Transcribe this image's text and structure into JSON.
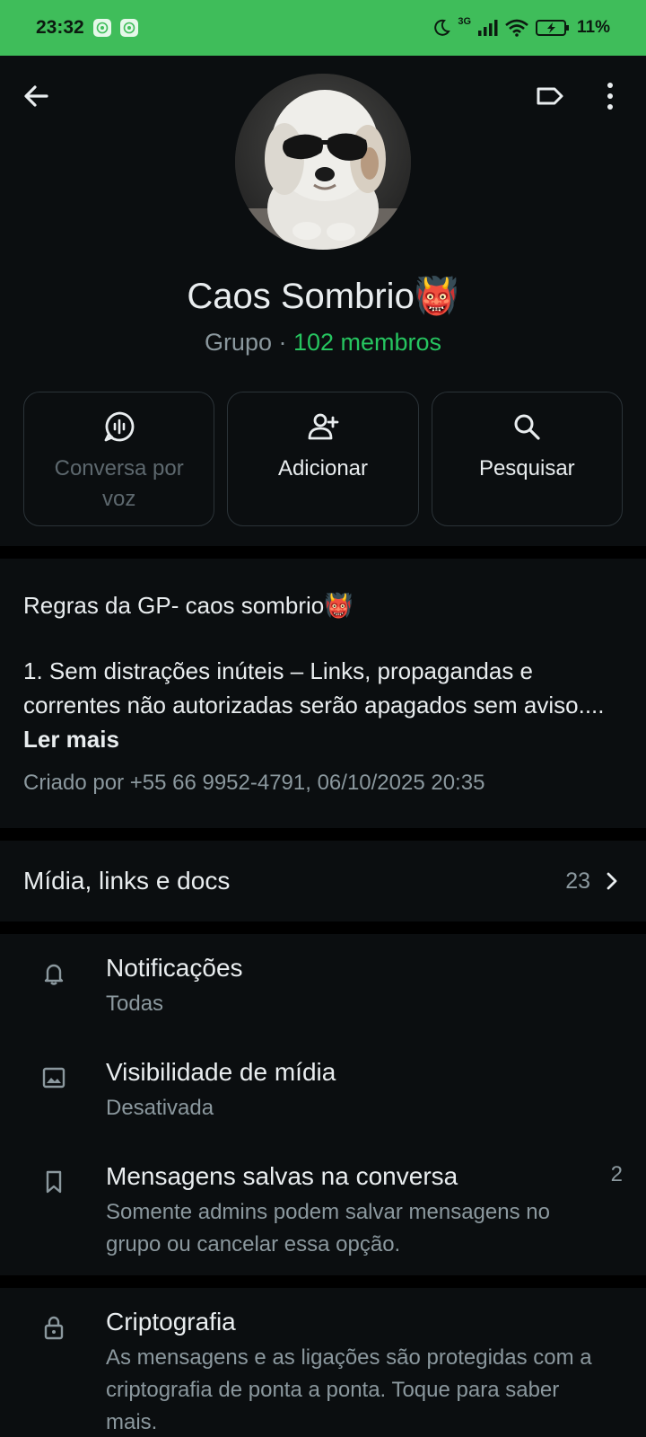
{
  "status_bar": {
    "time": "23:32",
    "network": "3G",
    "battery": "11%"
  },
  "header": {
    "back_icon": "arrow-left-icon",
    "label_icon": "label-tag-icon",
    "more_icon": "more-vertical-icon"
  },
  "group": {
    "title": "Caos Sombrio👹",
    "type": "Grupo",
    "separator": " · ",
    "members": "102 membros"
  },
  "actions": [
    {
      "label_line1": "Conversa por",
      "label_line2": "voz",
      "icon": "voice-chat-icon",
      "disabled": true
    },
    {
      "label": "Adicionar",
      "icon": "add-person-icon"
    },
    {
      "label": "Pesquisar",
      "icon": "search-icon"
    }
  ],
  "description": {
    "title": "Regras da GP- caos sombrio👹",
    "text": "1. Sem distrações inúteis – Links, propagandas e correntes não autorizadas serão apagados sem aviso....",
    "read_more": "Ler mais",
    "meta": "Criado por +55 66 9952-4791, 06/10/2025 20:35"
  },
  "media": {
    "label": "Mídia, links e docs",
    "count": "23"
  },
  "settings": [
    {
      "title": "Notificações",
      "subtitle": "Todas",
      "icon": "bell-icon"
    },
    {
      "title": "Visibilidade de mídia",
      "subtitle": "Desativada",
      "icon": "image-icon"
    },
    {
      "title": "Mensagens salvas na conversa",
      "subtitle": "Somente admins podem salvar mensagens no grupo ou cancelar essa opção.",
      "count": "2",
      "icon": "bookmark-icon"
    }
  ],
  "encryption": {
    "title": "Criptografia",
    "subtitle": "As mensagens e as ligações são protegidas com a criptografia de ponta a ponta. Toque para saber mais.",
    "icon": "lock-icon"
  },
  "colors": {
    "status_bar": "#3fbd5a",
    "accent_green": "#26c560",
    "background": "#0b0e10",
    "secondary_text": "#8b989e"
  }
}
